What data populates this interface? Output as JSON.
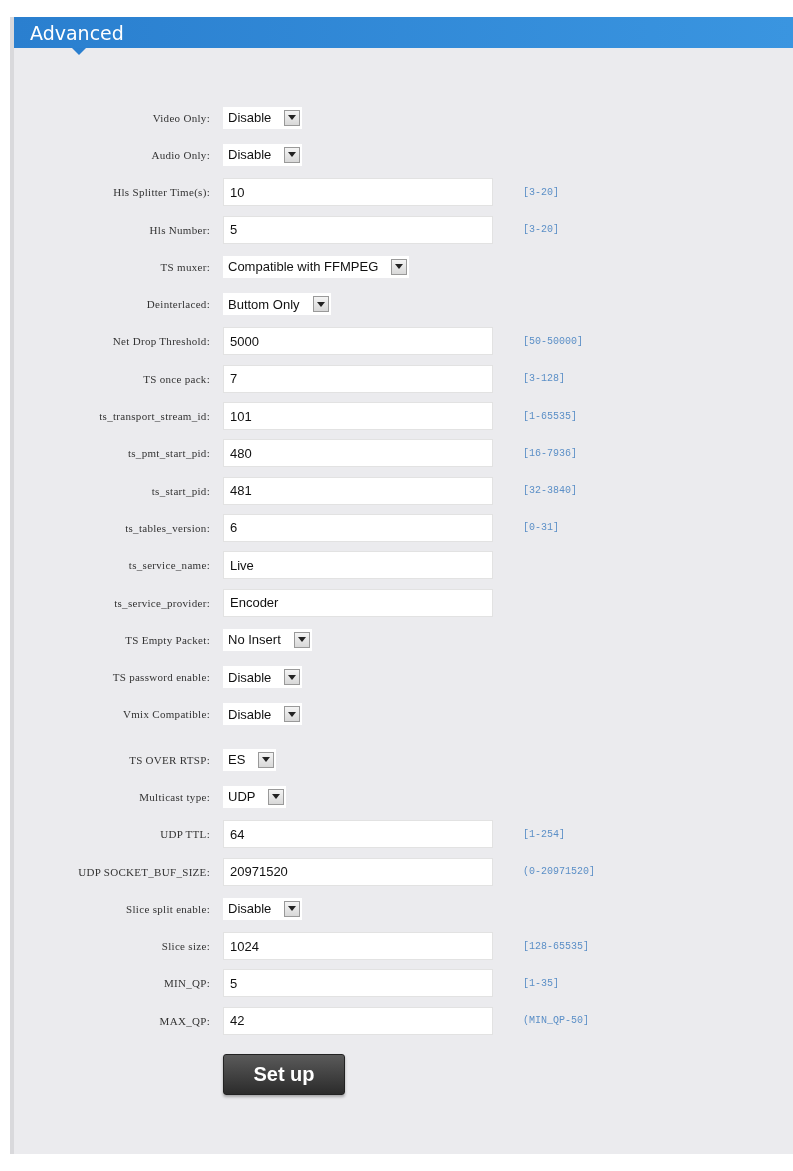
{
  "panel": {
    "title": "Advanced"
  },
  "fields": [
    {
      "label": "Video Only:",
      "kind": "select",
      "value": "Disable"
    },
    {
      "label": "Audio Only:",
      "kind": "select",
      "value": "Disable"
    },
    {
      "label": "Hls Splitter Time(s):",
      "kind": "text",
      "value": "10",
      "hint": "[3-20]"
    },
    {
      "label": "Hls Number:",
      "kind": "text",
      "value": "5",
      "hint": "[3-20]"
    },
    {
      "label": "TS muxer:",
      "kind": "select",
      "value": "Compatible with FFMPEG"
    },
    {
      "label": "Deinterlaced:",
      "kind": "select",
      "value": "Buttom Only"
    },
    {
      "label": "Net Drop Threshold:",
      "kind": "text",
      "value": "5000",
      "hint": "[50-50000]"
    },
    {
      "label": "TS once pack:",
      "kind": "text",
      "value": "7",
      "hint": "[3-128]"
    },
    {
      "label": "ts_transport_stream_id:",
      "kind": "text",
      "value": "101",
      "hint": "[1-65535]"
    },
    {
      "label": "ts_pmt_start_pid:",
      "kind": "text",
      "value": "480",
      "hint": "[16-7936]"
    },
    {
      "label": "ts_start_pid:",
      "kind": "text",
      "value": "481",
      "hint": "[32-3840]"
    },
    {
      "label": "ts_tables_version:",
      "kind": "text",
      "value": "6",
      "hint": "[0-31]"
    },
    {
      "label": "ts_service_name:",
      "kind": "text",
      "value": "Live"
    },
    {
      "label": "ts_service_provider:",
      "kind": "text",
      "value": "Encoder"
    },
    {
      "label": "TS Empty Packet:",
      "kind": "select",
      "value": "No Insert"
    },
    {
      "label": "TS password enable:",
      "kind": "select",
      "value": "Disable"
    },
    {
      "label": "Vmix Compatible:",
      "kind": "select",
      "value": "Disable"
    },
    {
      "label": "TS OVER RTSP:",
      "kind": "select",
      "value": "ES"
    },
    {
      "label": "Multicast type:",
      "kind": "select",
      "value": "UDP"
    },
    {
      "label": "UDP TTL:",
      "kind": "text",
      "value": "64",
      "hint": "[1-254]"
    },
    {
      "label": "UDP SOCKET_BUF_SIZE:",
      "kind": "text",
      "value": "20971520",
      "hint": "(0-20971520]"
    },
    {
      "label": "Slice split enable:",
      "kind": "select",
      "value": "Disable"
    },
    {
      "label": "Slice size:",
      "kind": "text",
      "value": "1024",
      "hint": "[128-65535]"
    },
    {
      "label": "MIN_QP:",
      "kind": "text",
      "value": "5",
      "hint": "[1-35]"
    },
    {
      "label": "MAX_QP:",
      "kind": "text",
      "value": "42",
      "hint": "(MIN_QP-50]"
    }
  ],
  "submit": "Set up"
}
